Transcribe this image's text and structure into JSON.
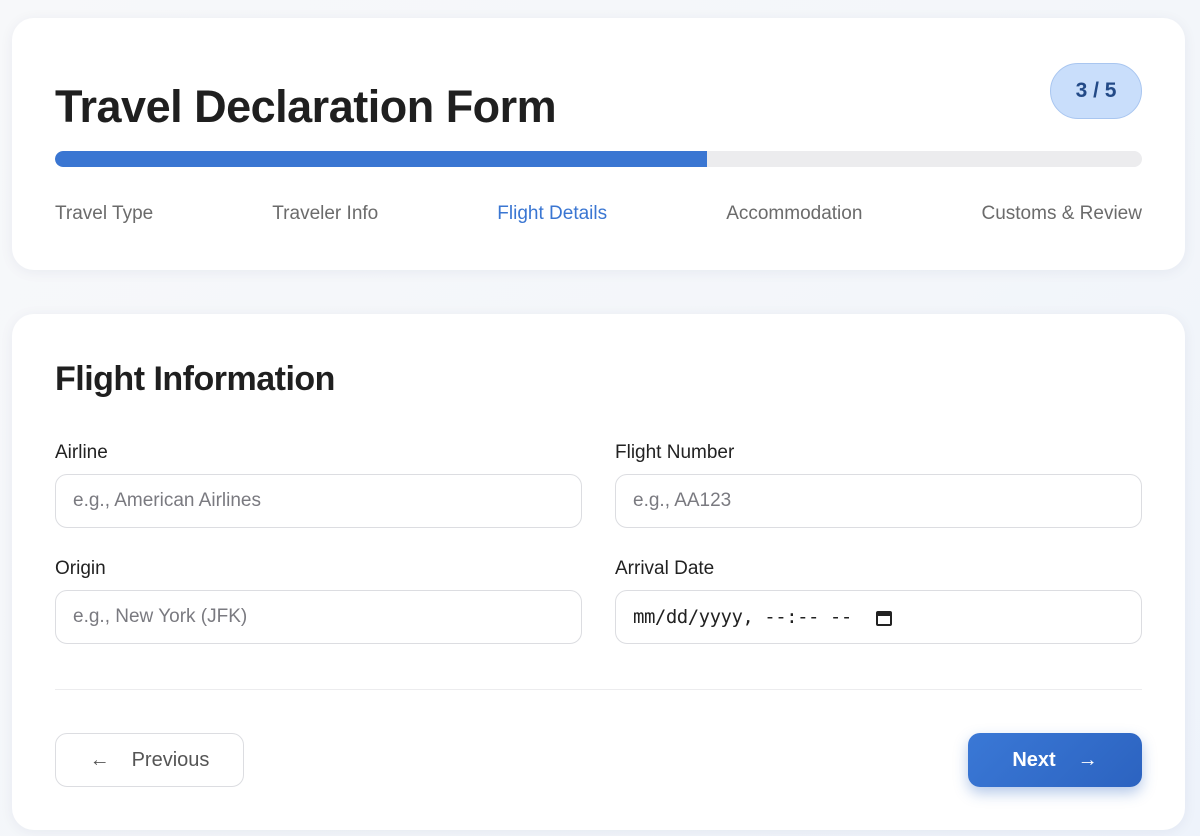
{
  "header": {
    "title": "Travel Declaration Form",
    "step_indicator": "3 / 5",
    "progress_percent": 60,
    "steps": [
      {
        "label": "Travel Type",
        "active": false
      },
      {
        "label": "Traveler Info",
        "active": false
      },
      {
        "label": "Flight Details",
        "active": true
      },
      {
        "label": "Accommodation",
        "active": false
      },
      {
        "label": "Customs & Review",
        "active": false
      }
    ]
  },
  "form": {
    "section_title": "Flight Information",
    "airline": {
      "label": "Airline",
      "placeholder": "e.g., American Airlines",
      "value": ""
    },
    "flight_number": {
      "label": "Flight Number",
      "placeholder": "e.g., AA123",
      "value": ""
    },
    "origin": {
      "label": "Origin",
      "placeholder": "e.g., New York (JFK)",
      "value": ""
    },
    "arrival_date": {
      "label": "Arrival Date",
      "placeholder": "mm/dd/yyyy, --:-- --",
      "value": ""
    }
  },
  "nav": {
    "previous_label": "Previous",
    "next_label": "Next",
    "previous_icon": "arrow-left-icon",
    "next_icon": "arrow-right-icon"
  },
  "colors": {
    "accent": "#3a76d2",
    "badge_bg": "#c9defb",
    "badge_text": "#234a87"
  }
}
